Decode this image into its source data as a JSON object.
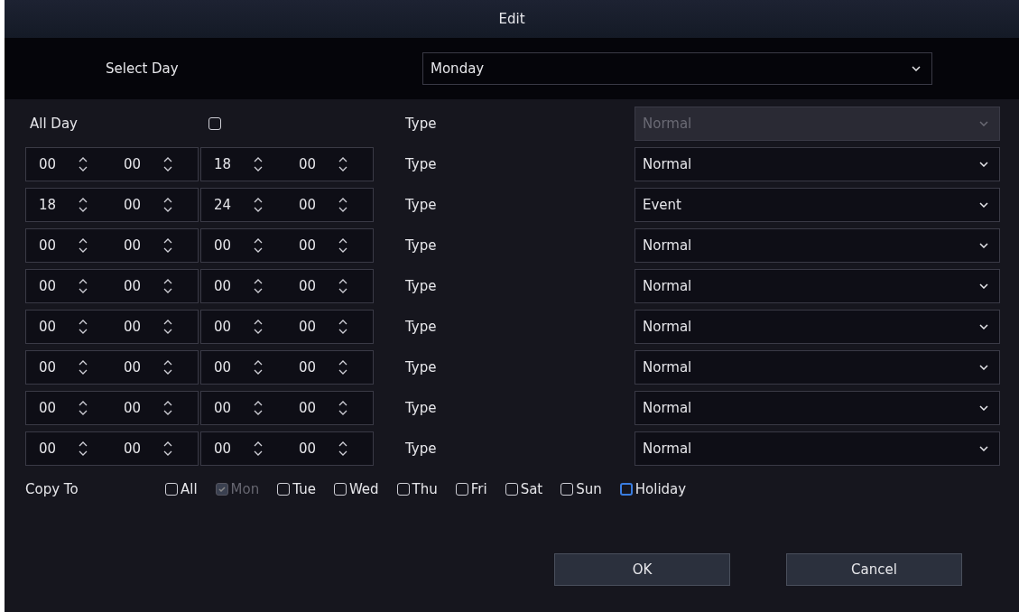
{
  "window": {
    "title": "Edit"
  },
  "select_day": {
    "label": "Select Day",
    "value": "Monday"
  },
  "all_day": {
    "label": "All Day",
    "checked": false,
    "type_label": "Type",
    "type": "Normal",
    "type_disabled": true
  },
  "periods": [
    {
      "start_hour": "00",
      "start_minute": "00",
      "end_hour": "18",
      "end_minute": "00",
      "type_label": "Type",
      "type": "Normal"
    },
    {
      "start_hour": "18",
      "start_minute": "00",
      "end_hour": "24",
      "end_minute": "00",
      "type_label": "Type",
      "type": "Event"
    },
    {
      "start_hour": "00",
      "start_minute": "00",
      "end_hour": "00",
      "end_minute": "00",
      "type_label": "Type",
      "type": "Normal"
    },
    {
      "start_hour": "00",
      "start_minute": "00",
      "end_hour": "00",
      "end_minute": "00",
      "type_label": "Type",
      "type": "Normal"
    },
    {
      "start_hour": "00",
      "start_minute": "00",
      "end_hour": "00",
      "end_minute": "00",
      "type_label": "Type",
      "type": "Normal"
    },
    {
      "start_hour": "00",
      "start_minute": "00",
      "end_hour": "00",
      "end_minute": "00",
      "type_label": "Type",
      "type": "Normal"
    },
    {
      "start_hour": "00",
      "start_minute": "00",
      "end_hour": "00",
      "end_minute": "00",
      "type_label": "Type",
      "type": "Normal"
    },
    {
      "start_hour": "00",
      "start_minute": "00",
      "end_hour": "00",
      "end_minute": "00",
      "type_label": "Type",
      "type": "Normal"
    }
  ],
  "copy_to": {
    "label": "Copy To",
    "options": [
      {
        "label": "All",
        "checked": false,
        "disabled": false,
        "focused": false
      },
      {
        "label": "Mon",
        "checked": true,
        "disabled": true,
        "focused": false
      },
      {
        "label": "Tue",
        "checked": false,
        "disabled": false,
        "focused": false
      },
      {
        "label": "Wed",
        "checked": false,
        "disabled": false,
        "focused": false
      },
      {
        "label": "Thu",
        "checked": false,
        "disabled": false,
        "focused": false
      },
      {
        "label": "Fri",
        "checked": false,
        "disabled": false,
        "focused": false
      },
      {
        "label": "Sat",
        "checked": false,
        "disabled": false,
        "focused": false
      },
      {
        "label": "Sun",
        "checked": false,
        "disabled": false,
        "focused": false
      },
      {
        "label": "Holiday",
        "checked": false,
        "disabled": false,
        "focused": true
      }
    ]
  },
  "buttons": [
    "OK",
    "Cancel"
  ]
}
